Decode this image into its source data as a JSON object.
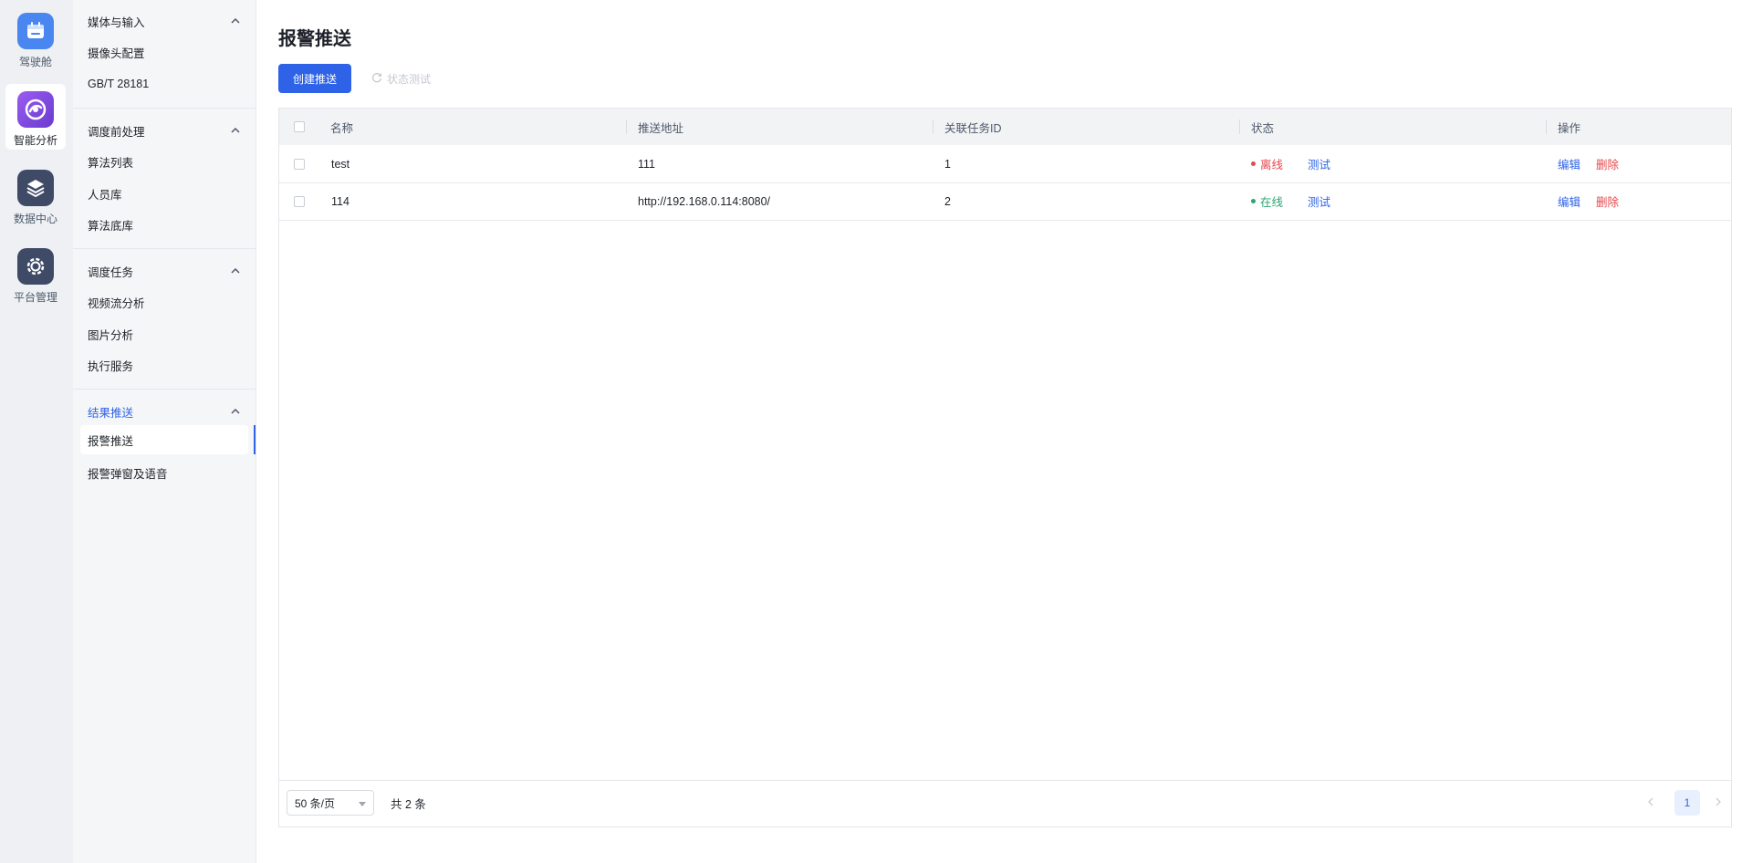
{
  "rail": {
    "items": [
      {
        "label": "驾驶舱",
        "icon": "calendar-icon",
        "color": "#4a86f0"
      },
      {
        "label": "智能分析",
        "icon": "analysis-icon",
        "color": "#7a45d6"
      },
      {
        "label": "数据中心",
        "icon": "layers-icon",
        "color": "#3e4a66"
      },
      {
        "label": "平台管理",
        "icon": "gear-icon",
        "color": "#3e4a66"
      }
    ]
  },
  "subnav": {
    "groups": [
      {
        "title": "媒体与输入",
        "items": [
          "摄像头配置",
          "GB/T 28181"
        ]
      },
      {
        "title": "调度前处理",
        "items": [
          "算法列表",
          "人员库",
          "算法底库"
        ]
      },
      {
        "title": "调度任务",
        "items": [
          "视频流分析",
          "图片分析",
          "执行服务"
        ]
      },
      {
        "title": "结果推送",
        "items": [
          "报警推送",
          "报警弹窗及语音"
        ]
      }
    ]
  },
  "page": {
    "title": "报警推送",
    "create_label": "创建推送",
    "status_test_label": "状态测试"
  },
  "table": {
    "headers": [
      "名称",
      "推送地址",
      "关联任务ID",
      "状态",
      "操作"
    ],
    "rows": [
      {
        "name": "test",
        "address": "111",
        "task_id": "1",
        "status": "离线",
        "status_color": "#e5484d",
        "test": "测试",
        "edit": "编辑",
        "delete": "删除"
      },
      {
        "name": "114",
        "address": "http://192.168.0.114:8080/",
        "task_id": "2",
        "status": "在线",
        "status_color": "#2ba471",
        "test": "测试",
        "edit": "编辑",
        "delete": "删除"
      }
    ]
  },
  "pagination": {
    "page_size": "50 条/页",
    "total": "共 2 条",
    "current_page": "1"
  },
  "colors": {
    "primary": "#2e63e8",
    "danger": "#e5484d",
    "success": "#2ba471"
  }
}
